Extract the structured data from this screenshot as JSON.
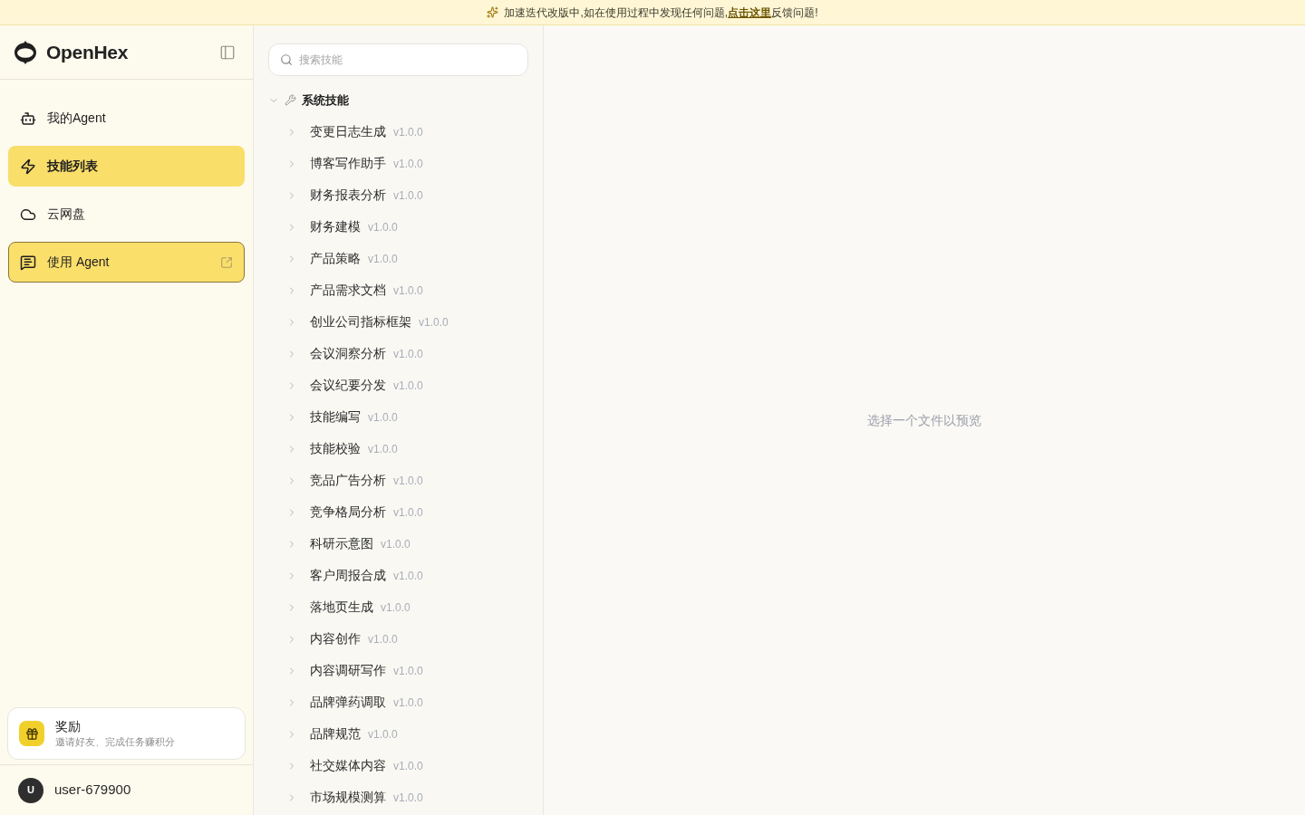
{
  "banner": {
    "text_before": "加速迭代改版中,如在使用过程中发现任何问题,",
    "link": "点击这里",
    "text_after": "反馈问题!"
  },
  "sidebar": {
    "brand": "OpenHex",
    "nav": [
      {
        "label": "我的Agent",
        "kind": "page",
        "selected": false
      },
      {
        "label": "技能列表",
        "kind": "page",
        "selected": true
      },
      {
        "label": "云网盘",
        "kind": "page",
        "selected": false
      },
      {
        "label": "使用 Agent",
        "kind": "external",
        "selected": false
      }
    ],
    "reward": {
      "title": "奖励",
      "subtitle": "邀请好友、完成任务赚积分"
    },
    "user": {
      "avatar": "U",
      "name": "user-679900"
    }
  },
  "skills": {
    "search": {
      "placeholder": "搜索技能"
    },
    "tree": [
      {
        "label": "系统技能",
        "expanded": true,
        "children": [
          {
            "label": "变更日志生成",
            "version": "v1.0.0",
            "expanded": false
          },
          {
            "label": "博客写作助手",
            "version": "v1.0.0",
            "expanded": false
          },
          {
            "label": "财务报表分析",
            "version": "v1.0.0",
            "expanded": false
          },
          {
            "label": "财务建模",
            "version": "v1.0.0",
            "expanded": false
          },
          {
            "label": "产品策略",
            "version": "v1.0.0",
            "expanded": false
          },
          {
            "label": "产品需求文档",
            "version": "v1.0.0",
            "expanded": false
          },
          {
            "label": "创业公司指标框架",
            "version": "v1.0.0",
            "expanded": false
          },
          {
            "label": "会议洞察分析",
            "version": "v1.0.0",
            "expanded": false
          },
          {
            "label": "会议纪要分发",
            "version": "v1.0.0",
            "expanded": false
          },
          {
            "label": "技能编写",
            "version": "v1.0.0",
            "expanded": false
          },
          {
            "label": "技能校验",
            "version": "v1.0.0",
            "expanded": false
          },
          {
            "label": "竞品广告分析",
            "version": "v1.0.0",
            "expanded": false
          },
          {
            "label": "竞争格局分析",
            "version": "v1.0.0",
            "expanded": false
          },
          {
            "label": "科研示意图",
            "version": "v1.0.0",
            "expanded": false
          },
          {
            "label": "客户周报合成",
            "version": "v1.0.0",
            "expanded": false
          },
          {
            "label": "落地页生成",
            "version": "v1.0.0",
            "expanded": false
          },
          {
            "label": "内容创作",
            "version": "v1.0.0",
            "expanded": false
          },
          {
            "label": "内容调研写作",
            "version": "v1.0.0",
            "expanded": false
          },
          {
            "label": "品牌弹药调取",
            "version": "v1.0.0",
            "expanded": false
          },
          {
            "label": "品牌规范",
            "version": "v1.0.0",
            "expanded": false
          },
          {
            "label": "社交媒体内容",
            "version": "v1.0.0",
            "expanded": false
          },
          {
            "label": "市场规模测算",
            "version": "v1.0.0",
            "expanded": false
          }
        ]
      }
    ]
  },
  "preview": {
    "empty_message": "选择一个文件以预览"
  }
}
